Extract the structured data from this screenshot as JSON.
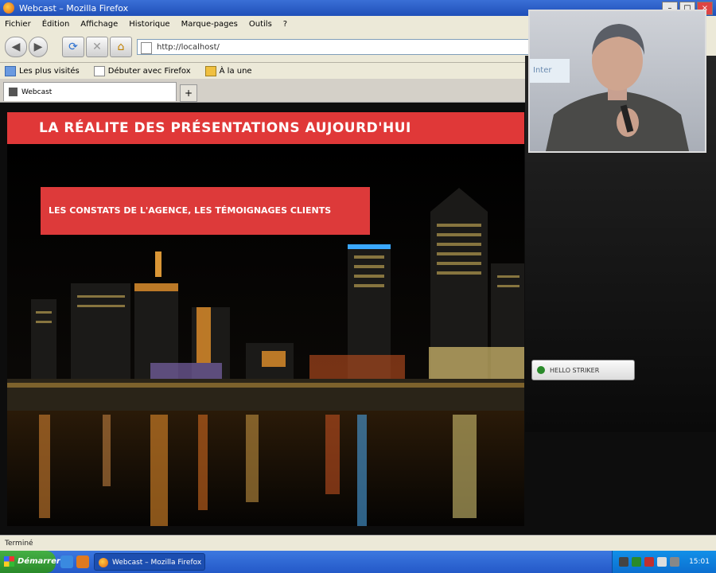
{
  "window": {
    "title": "Webcast – Mozilla Firefox"
  },
  "menu": [
    "Fichier",
    "Édition",
    "Affichage",
    "Historique",
    "Marque-pages",
    "Outils",
    "?"
  ],
  "navigation": {
    "url": "http://localhost/"
  },
  "bookmarks": [
    "Les plus visités",
    "Débuter avec Firefox",
    "À la une"
  ],
  "tab": {
    "label": "Webcast"
  },
  "slide": {
    "title": "LA RÉALITE DES PRÉSENTATIONS AUJOURD'HUI",
    "subtitle": "LES CONSTATS DE L'AGENCE, LES TÉMOIGNAGES CLIENTS"
  },
  "video": {
    "sign_text": "Inter"
  },
  "notification": {
    "label": "HELLO STRIKER"
  },
  "statusbar": {
    "text": "Terminé"
  },
  "taskbar": {
    "start_label": "Démarrer",
    "task_item": "Webcast – Mozilla Firefox",
    "clock": "15:01"
  },
  "colors": {
    "slide_red": "#e03838",
    "background": "#0d0d0d"
  }
}
